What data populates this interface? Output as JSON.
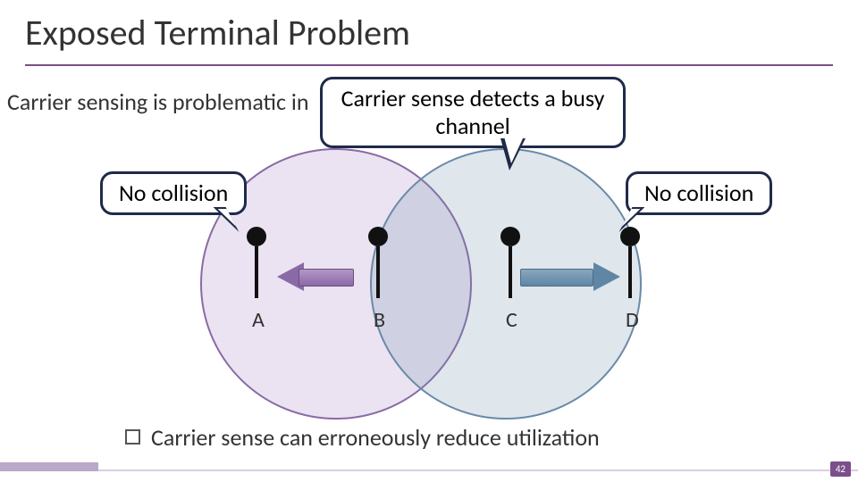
{
  "title": "Exposed Terminal Problem",
  "subtitle": "Carrier sensing is problematic in",
  "callouts": {
    "top": "Carrier sense detects a busy channel",
    "left": "No collision",
    "right": "No collision"
  },
  "nodes": {
    "a": "A",
    "b": "B",
    "c": "C",
    "d": "D"
  },
  "bullet": "Carrier sense can erroneously reduce utilization",
  "page": "42",
  "chart_data": {
    "type": "diagram",
    "description": "Exposed terminal problem: four nodes A,B,C,D in a line. B's range covers A and C; C's range covers B and D. B transmits to A (purple left arrow) while C wants to transmit to D (blue right arrow). C senses B's carrier and defers even though C→D would not collide with B→A.",
    "nodes": [
      "A",
      "B",
      "C",
      "D"
    ],
    "ranges": [
      {
        "center": "B",
        "covers": [
          "A",
          "C"
        ],
        "color": "#8a6aa6"
      },
      {
        "center": "C",
        "covers": [
          "B",
          "D"
        ],
        "color": "#6a8aa8"
      }
    ],
    "transmissions": [
      {
        "from": "B",
        "to": "A",
        "color": "purple",
        "outcome": "No collision"
      },
      {
        "from": "C",
        "to": "D",
        "color": "blue",
        "outcome": "No collision",
        "note": "Carrier sense detects a busy channel"
      }
    ],
    "conclusion": "Carrier sense can erroneously reduce utilization"
  }
}
